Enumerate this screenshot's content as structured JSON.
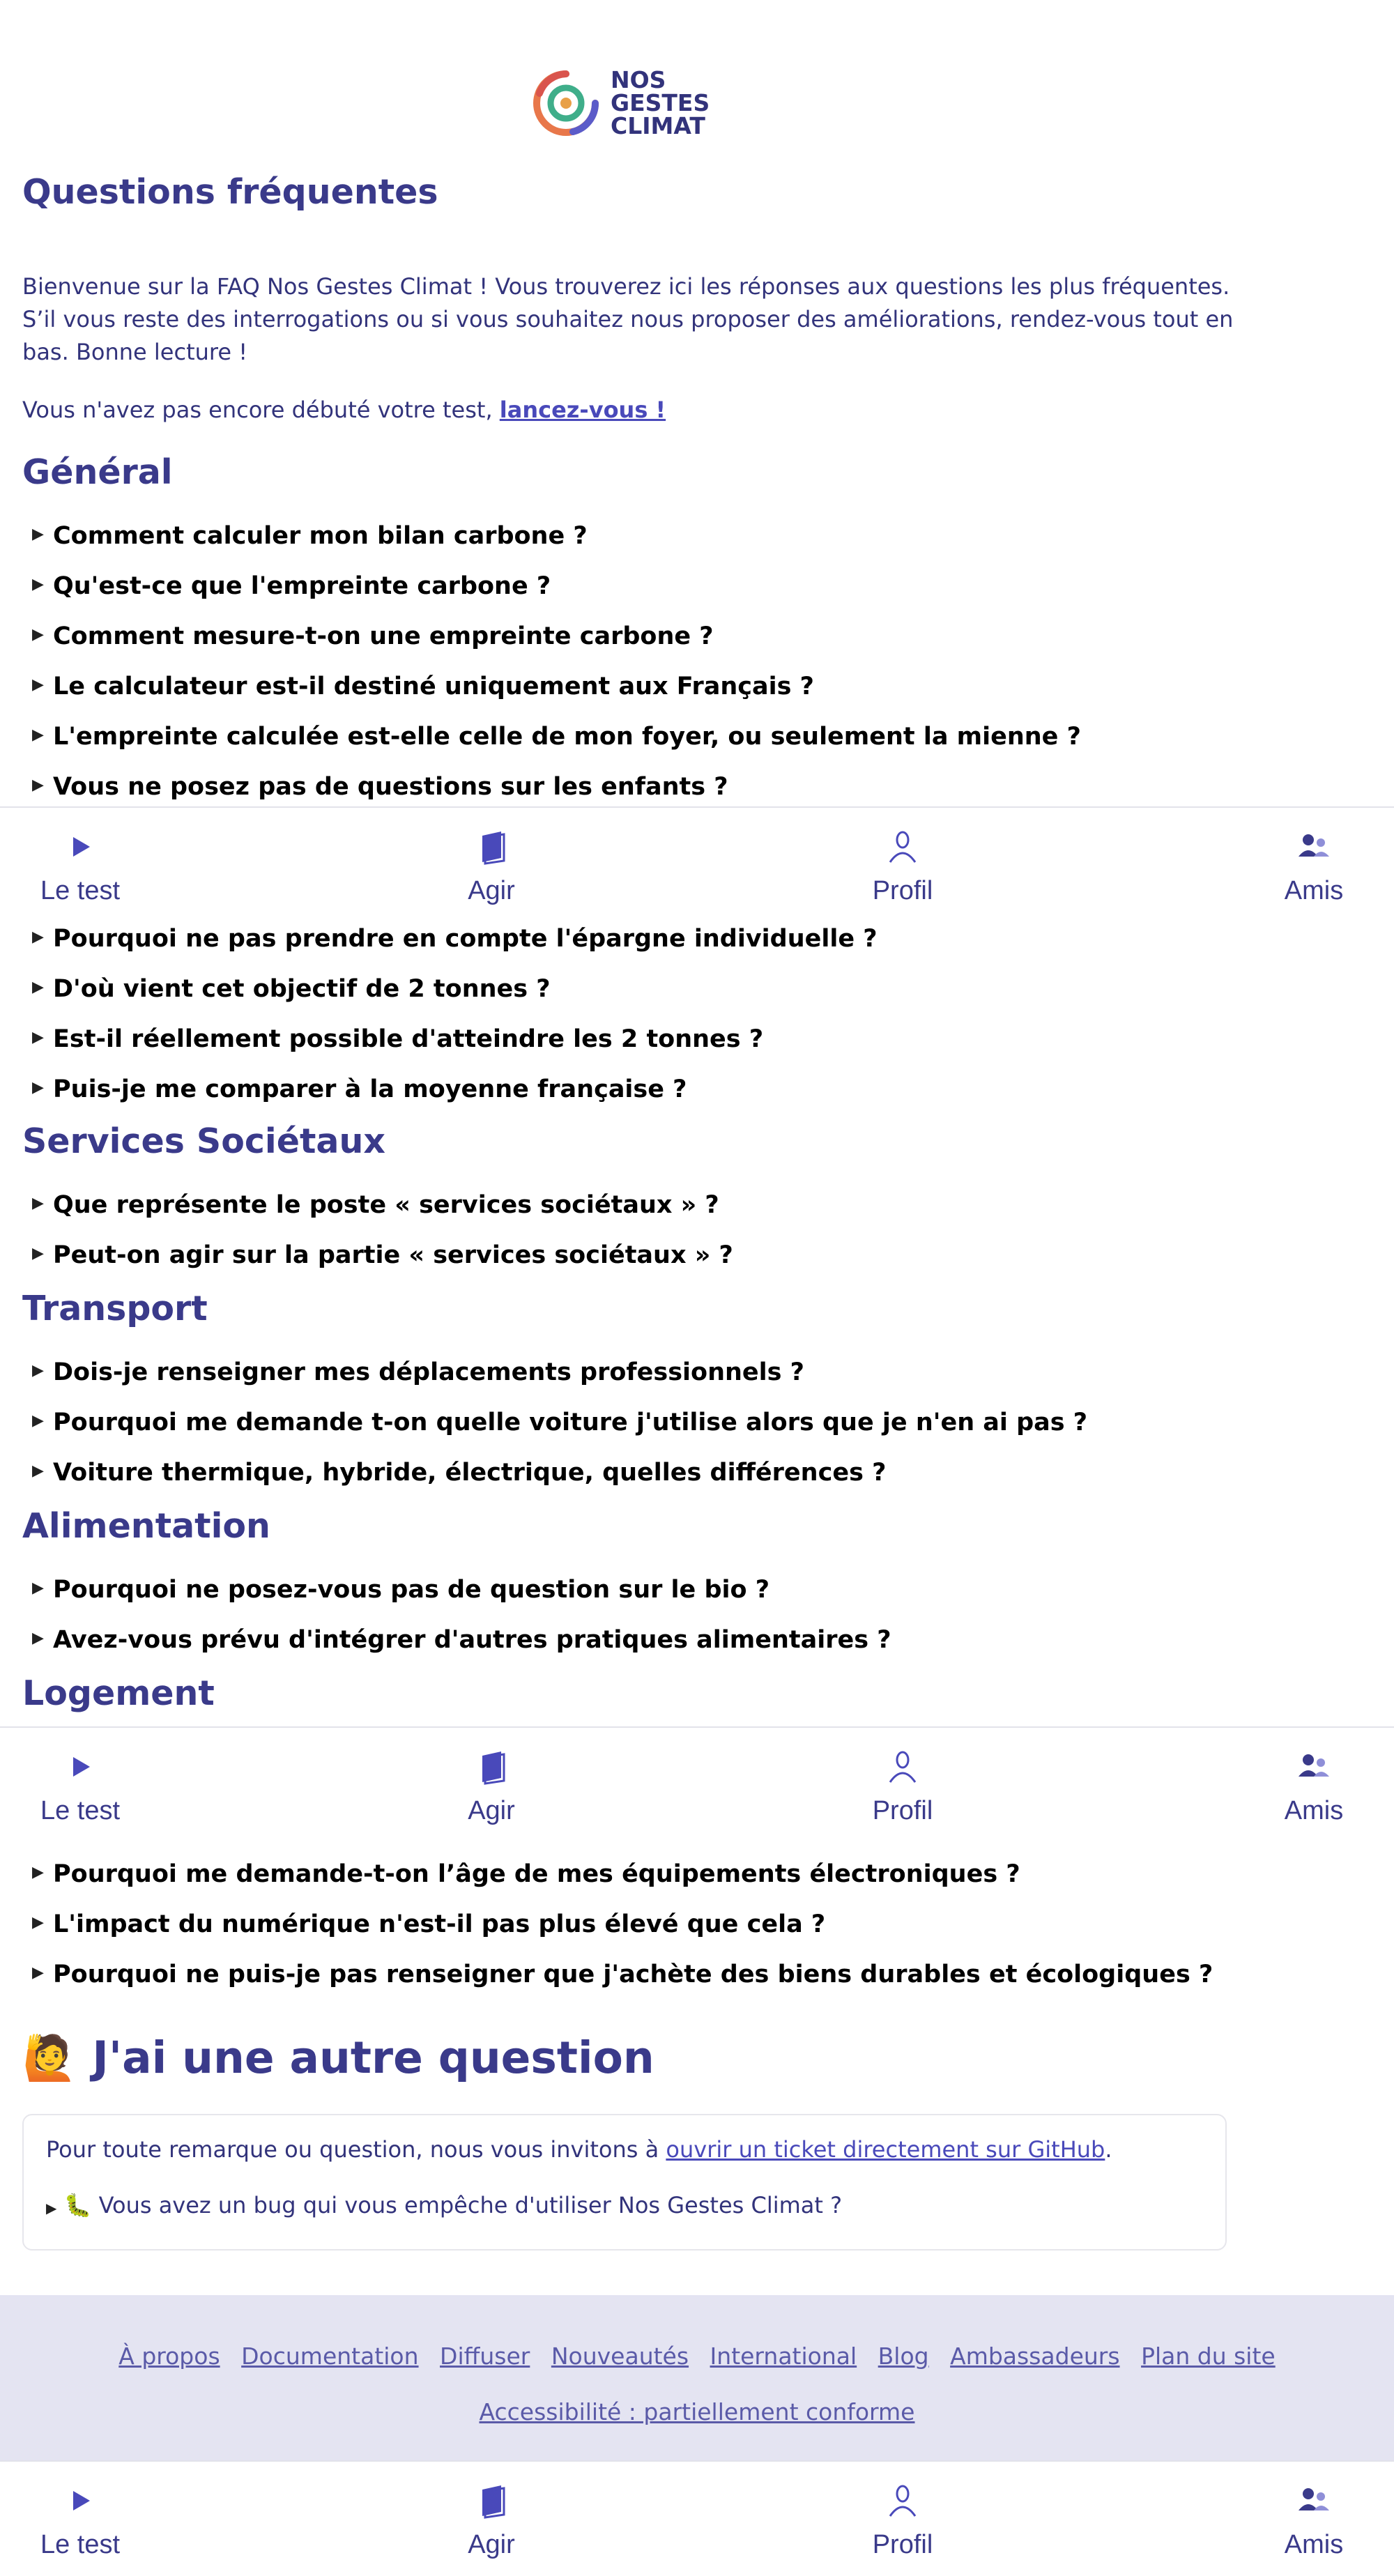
{
  "brand": {
    "lines": [
      "NOS",
      "GESTES",
      "CLIMAT"
    ]
  },
  "page_title": "Questions fréquentes",
  "intro": {
    "paragraph": "Bienvenue sur la FAQ Nos Gestes Climat ! Vous trouverez ici les réponses aux questions les plus fréquentes. S’il vous reste des interrogations ou si vous souhaitez nous proposer des améliorations, rendez-vous tout en bas. Bonne lecture !",
    "start_prefix": "Vous n'avez pas encore débuté votre test, ",
    "start_link": "lancez-vous !"
  },
  "sections": {
    "general": {
      "title": "Général",
      "questions": [
        "Comment calculer mon bilan carbone ?",
        "Qu'est-ce que l'empreinte carbone ?",
        "Comment mesure-t-on une empreinte carbone ?",
        "Le calculateur est-il destiné uniquement aux Français ?",
        "L'empreinte calculée est-elle celle de mon foyer, ou seulement la mienne ?",
        "Vous ne posez pas de questions sur les enfants ?",
        "Pourquoi ne pas prendre en compte l'épargne individuelle ?",
        "D'où vient cet objectif de 2 tonnes ?",
        "Est-il réellement possible d'atteindre les 2 tonnes ?",
        "Puis-je me comparer à la moyenne française ?"
      ]
    },
    "services": {
      "title": "Services Sociétaux",
      "questions": [
        "Que représente le poste « services sociétaux » ?",
        "Peut-on agir sur la partie « services sociétaux » ?"
      ]
    },
    "transport": {
      "title": "Transport",
      "questions": [
        "Dois-je renseigner mes déplacements professionnels ?",
        "Pourquoi me demande t-on quelle voiture j'utilise alors que je n'en ai pas ?",
        "Voiture thermique, hybride, électrique, quelles différences ?"
      ]
    },
    "alimentation": {
      "title": "Alimentation",
      "questions": [
        "Pourquoi ne posez-vous pas de question sur le bio ?",
        "Avez-vous prévu d'intégrer d'autres pratiques alimentaires ?"
      ]
    },
    "logement": {
      "title": "Logement",
      "questions": [
        "Pourquoi me demande-t-on l’âge de mes équipements électroniques ?",
        "L'impact du numérique n'est-il pas plus élevé que cela ?",
        "Pourquoi ne puis-je pas renseigner que j'achète des biens durables et écologiques ?"
      ]
    }
  },
  "nav": {
    "items": [
      "Le test",
      "Agir",
      "Profil",
      "Amis"
    ],
    "icons": [
      "play-icon",
      "book-icon",
      "profile-icon",
      "friends-icon"
    ],
    "active_color": "#4949ba"
  },
  "other": {
    "emoji": "🙋",
    "title": "J'ai une autre question",
    "text_prefix": "Pour toute remarque ou question, nous vous invitons à ",
    "link": "ouvrir un ticket directement sur GitHub",
    "text_suffix": ".",
    "bug_emoji": "🐛",
    "bug_text": " Vous avez un bug qui vous empêche d'utiliser Nos Gestes Climat ?"
  },
  "footer": {
    "links": [
      "À propos",
      "Documentation",
      "Diffuser",
      "Nouveautés",
      "International",
      "Blog",
      "Ambassadeurs",
      "Plan du site"
    ],
    "accessibility": "Accessibilité : partiellement conforme"
  },
  "colors": {
    "primary": "#3a3a8a",
    "link": "#4949ba",
    "footer_bg": "#e4e4f2"
  }
}
